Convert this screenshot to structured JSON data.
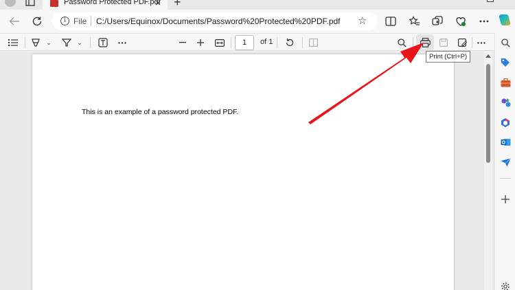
{
  "tab": {
    "title": "Password Protected PDF.pdf",
    "close": "×"
  },
  "newtab": "+",
  "address": {
    "scheme": "File",
    "url": "C:/Users/Equinox/Documents/Password%20Protected%20PDF.pdf"
  },
  "pdf_toolbar": {
    "page_current": "1",
    "page_total": "of 1"
  },
  "tooltip": "Print (Ctrl+P)",
  "document": {
    "text": "This is an example of a password protected PDF."
  },
  "colors": {
    "arrow": "#e8141a",
    "tab_pdf_icon": "#c7302b",
    "page_bg": "#ffffff",
    "viewer_bg": "#e9e9e9"
  }
}
